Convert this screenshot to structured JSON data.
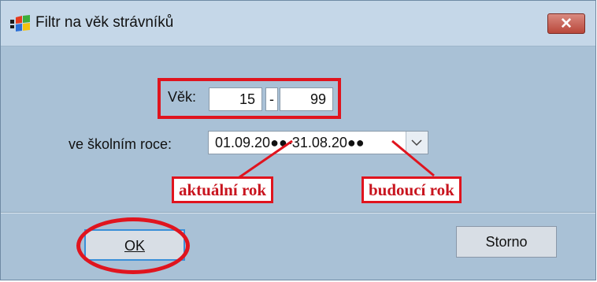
{
  "window": {
    "title": "Filtr na věk strávníků",
    "close_symbol": "✕"
  },
  "age": {
    "label": "Věk:",
    "from": "15",
    "separator": "-",
    "to": "99"
  },
  "school_year": {
    "label": "ve školním roce:",
    "value": "01.09.20●●-31.08.20●●"
  },
  "annotations": {
    "current_year": "aktuální rok",
    "next_year": "budoucí rok"
  },
  "buttons": {
    "ok": "OK",
    "cancel": "Storno"
  },
  "colors": {
    "window_bg": "#a9c1d6",
    "titlebar_bg": "#c5d7e8",
    "highlight_red": "#e0141e",
    "close_button": "#c9574b"
  }
}
